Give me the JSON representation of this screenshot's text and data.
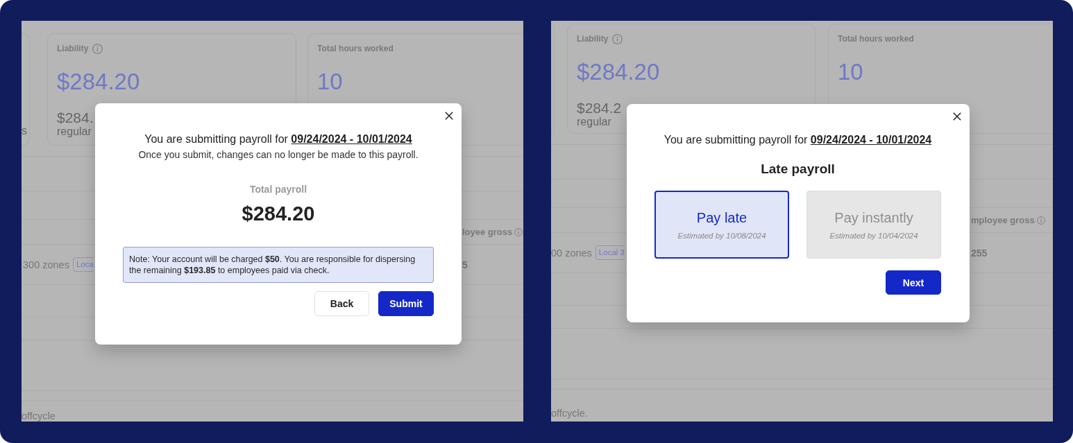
{
  "panels": [
    {
      "page": {
        "partial_card_text": "s",
        "cards": [
          {
            "label": "Liability",
            "info": true,
            "value": "$284.20",
            "sub_value": "$284.",
            "sub_label": "regular"
          },
          {
            "label": "Total hours worked",
            "info": false,
            "value": "10"
          }
        ],
        "column_header": {
          "text": "loyee gross",
          "info": true
        },
        "row": {
          "name": "300 zones",
          "tag": "Loca",
          "amount": "5"
        },
        "footer_text": "offcycle"
      },
      "dialog": {
        "kind": "confirm",
        "title": "You are submitting payroll for **09/24/2024 - 10/01/2024**",
        "subtitle": "Once you submit, changes can no longer be made to this payroll.",
        "total_label": "Total payroll",
        "total_value": "$284.20",
        "note": "Note: Your account will be charged **$50**. You are responsible for dispersing the remaining **$193.85** to employees paid via check.",
        "buttons": [
          {
            "label": "Back",
            "kind": "secondary"
          },
          {
            "label": "Submit",
            "kind": "primary"
          }
        ]
      }
    },
    {
      "page": {
        "cards": [
          {
            "label": "Liability",
            "info": true,
            "value": "$284.20",
            "sub_value": "$284.2",
            "sub_label": "regular"
          },
          {
            "label": "Total hours worked",
            "info": false,
            "value": "10"
          }
        ],
        "column_header": {
          "text": "mployee gross",
          "info": true
        },
        "row": {
          "name": "00 zones",
          "tag": "Local 3",
          "amount": "255"
        },
        "footer_text": "offcycle."
      },
      "dialog": {
        "kind": "choice",
        "title": "You are submitting payroll for **09/24/2024 - 10/01/2024**",
        "heading": "Late payroll",
        "options": [
          {
            "label": "Pay late",
            "estimate": "Estimated by 10/08/2024",
            "selected": true
          },
          {
            "label": "Pay instantly",
            "estimate": "Estimated by 10/04/2024",
            "selected": false
          }
        ],
        "buttons": [
          {
            "label": "Next",
            "kind": "primary"
          }
        ]
      }
    }
  ]
}
